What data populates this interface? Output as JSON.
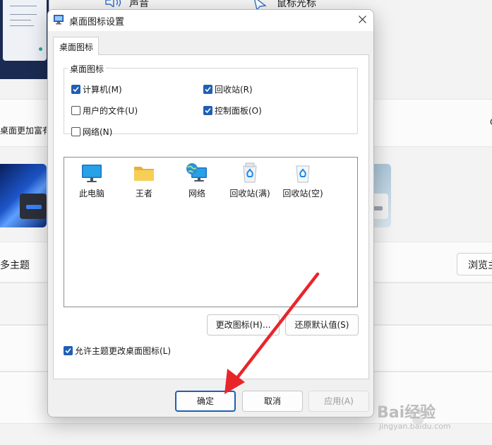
{
  "background": {
    "top_labels": [
      "声音",
      "鼠标光标"
    ],
    "band_text": "桌面更加富有",
    "more_themes": "多主题",
    "browse_button": "浏览主",
    "right_marker": "C"
  },
  "dialog": {
    "title": "桌面图标设置",
    "tab_label": "桌面图标",
    "group_title": "桌面图标",
    "checkboxes": [
      {
        "label": "计算机(M)",
        "checked": true
      },
      {
        "label": "回收站(R)",
        "checked": true
      },
      {
        "label": "用户的文件(U)",
        "checked": false
      },
      {
        "label": "控制面板(O)",
        "checked": true
      },
      {
        "label": "网络(N)",
        "checked": false
      }
    ],
    "icons": [
      {
        "label": "此电脑",
        "icon": "monitor-icon"
      },
      {
        "label": "王者",
        "icon": "folder-icon"
      },
      {
        "label": "网络",
        "icon": "network-globe-icon"
      },
      {
        "label": "回收站(满)",
        "icon": "recycle-bin-full-icon"
      },
      {
        "label": "回收站(空)",
        "icon": "recycle-bin-empty-icon"
      }
    ],
    "change_icon_button": "更改图标(H)...",
    "restore_default_button": "还原默认值(S)",
    "allow_themes_checkbox": {
      "label": "允许主题更改桌面图标(L)",
      "checked": true
    },
    "ok_button": "确定",
    "cancel_button": "取消",
    "apply_button": "应用(A)"
  },
  "colors": {
    "accent": "#1f5fb5",
    "annotation_arrow": "#e8262a"
  },
  "watermark": {
    "brand": "Bai经验",
    "url": "jingyan.baidu.com"
  }
}
